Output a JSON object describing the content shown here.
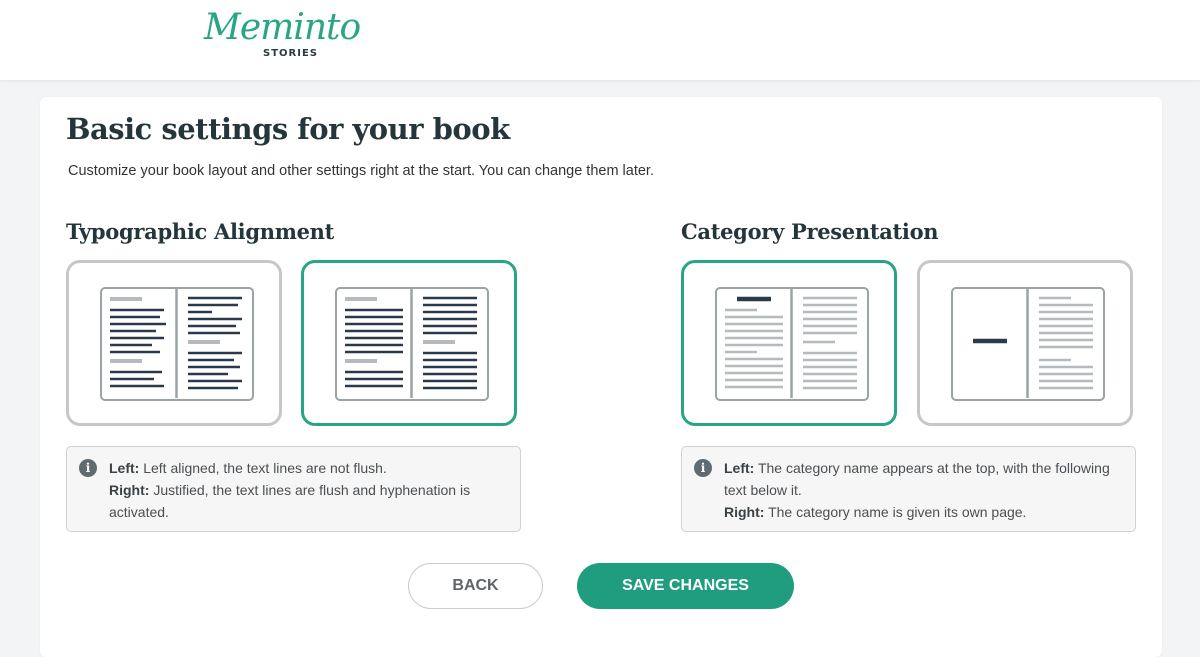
{
  "brand": {
    "script": "Meminto",
    "sub": "STORIES",
    "color": "#27a585"
  },
  "page": {
    "title": "Basic settings for your book",
    "subtitle": "Customize your book layout and other settings right at the start. You can change them later."
  },
  "typographic": {
    "title": "Typographic Alignment",
    "options": [
      {
        "name": "left-aligned",
        "selected": false
      },
      {
        "name": "justified",
        "selected": true
      }
    ],
    "info": {
      "left_label": "Left:",
      "left_text": " Left aligned, the text lines are not flush.",
      "right_label": "Right:",
      "right_text": " Justified, the text lines are flush and hyphenation is activated."
    }
  },
  "category": {
    "title": "Category Presentation",
    "options": [
      {
        "name": "name-on-top",
        "selected": true
      },
      {
        "name": "own-page",
        "selected": false
      }
    ],
    "info": {
      "left_label": "Left:",
      "left_text": " The category name appears at the top, with the following text below it.",
      "right_label": "Right:",
      "right_text": " The category name is given its own page."
    }
  },
  "actions": {
    "back_label": "BACK",
    "save_label": "SAVE CHANGES"
  },
  "colors": {
    "accent": "#27a585",
    "button": "#1f9d7e",
    "heading": "#24363c",
    "line_dark": "#2b3a4a",
    "line_light": "#b4babd"
  },
  "icons": {
    "info": "info-circle-icon"
  }
}
